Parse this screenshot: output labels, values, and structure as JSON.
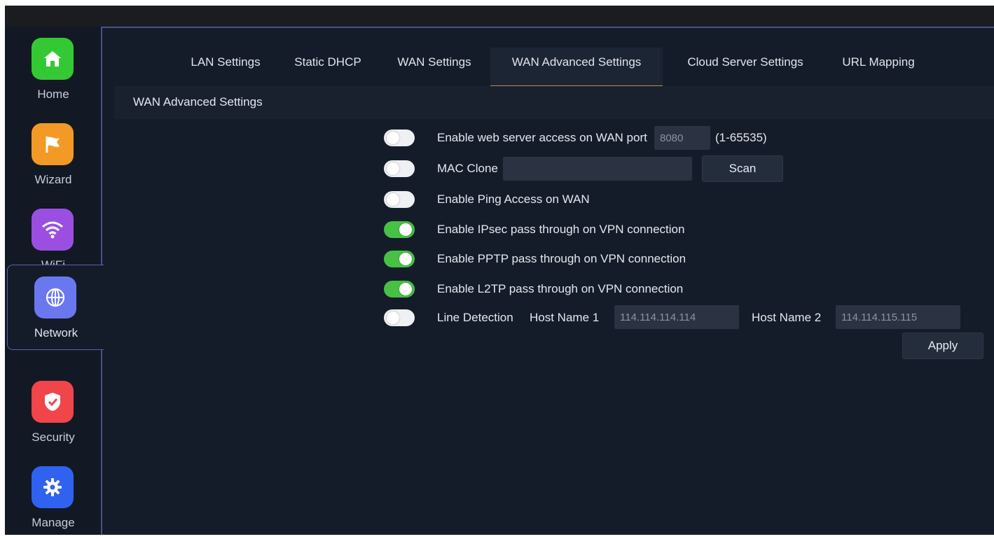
{
  "sidebar": {
    "items": [
      {
        "label": "Home",
        "icon": "home-icon",
        "color": "#34c934"
      },
      {
        "label": "Wizard",
        "icon": "flag-icon",
        "color": "#f29a25"
      },
      {
        "label": "WiFi",
        "icon": "wifi-icon",
        "color": "#9b4fe0"
      },
      {
        "label": "Network",
        "icon": "globe-icon",
        "color": "#6a78f0"
      },
      {
        "label": "Security",
        "icon": "shield-icon",
        "color": "#f0454a"
      },
      {
        "label": "Manage",
        "icon": "gear-icon",
        "color": "#2f63ef"
      }
    ],
    "active": "Network"
  },
  "tabs": [
    {
      "label": "LAN Settings"
    },
    {
      "label": "Static DHCP"
    },
    {
      "label": "WAN Settings"
    },
    {
      "label": "WAN Advanced Settings"
    },
    {
      "label": "Cloud Server Settings"
    },
    {
      "label": "URL Mapping"
    }
  ],
  "active_tab": "WAN Advanced Settings",
  "section_title": "WAN Advanced Settings",
  "settings": {
    "web_access": {
      "label": "Enable web server access on WAN port",
      "on": false,
      "port_value": "8080",
      "range_label": "(1-65535)"
    },
    "mac_clone": {
      "label": "MAC Clone",
      "on": false,
      "value": "",
      "scan_label": "Scan"
    },
    "ping": {
      "label": "Enable Ping Access on WAN",
      "on": false
    },
    "ipsec": {
      "label": "Enable IPsec pass through on VPN connection",
      "on": true
    },
    "pptp": {
      "label": "Enable PPTP pass through on VPN connection",
      "on": true
    },
    "l2tp": {
      "label": "Enable L2TP pass through on VPN connection",
      "on": true
    },
    "line_detection": {
      "label": "Line Detection",
      "on": false,
      "host1_label": "Host Name 1",
      "host1_value": "114.114.114.114",
      "host2_label": "Host Name 2",
      "host2_value": "114.114.115.115"
    }
  },
  "apply_label": "Apply",
  "colors": {
    "toggle_on": "#46c146",
    "toggle_off": "#eef0f3",
    "active_tab_underline": "#c58b3d",
    "sidebar_accent": "#5b60b3"
  }
}
